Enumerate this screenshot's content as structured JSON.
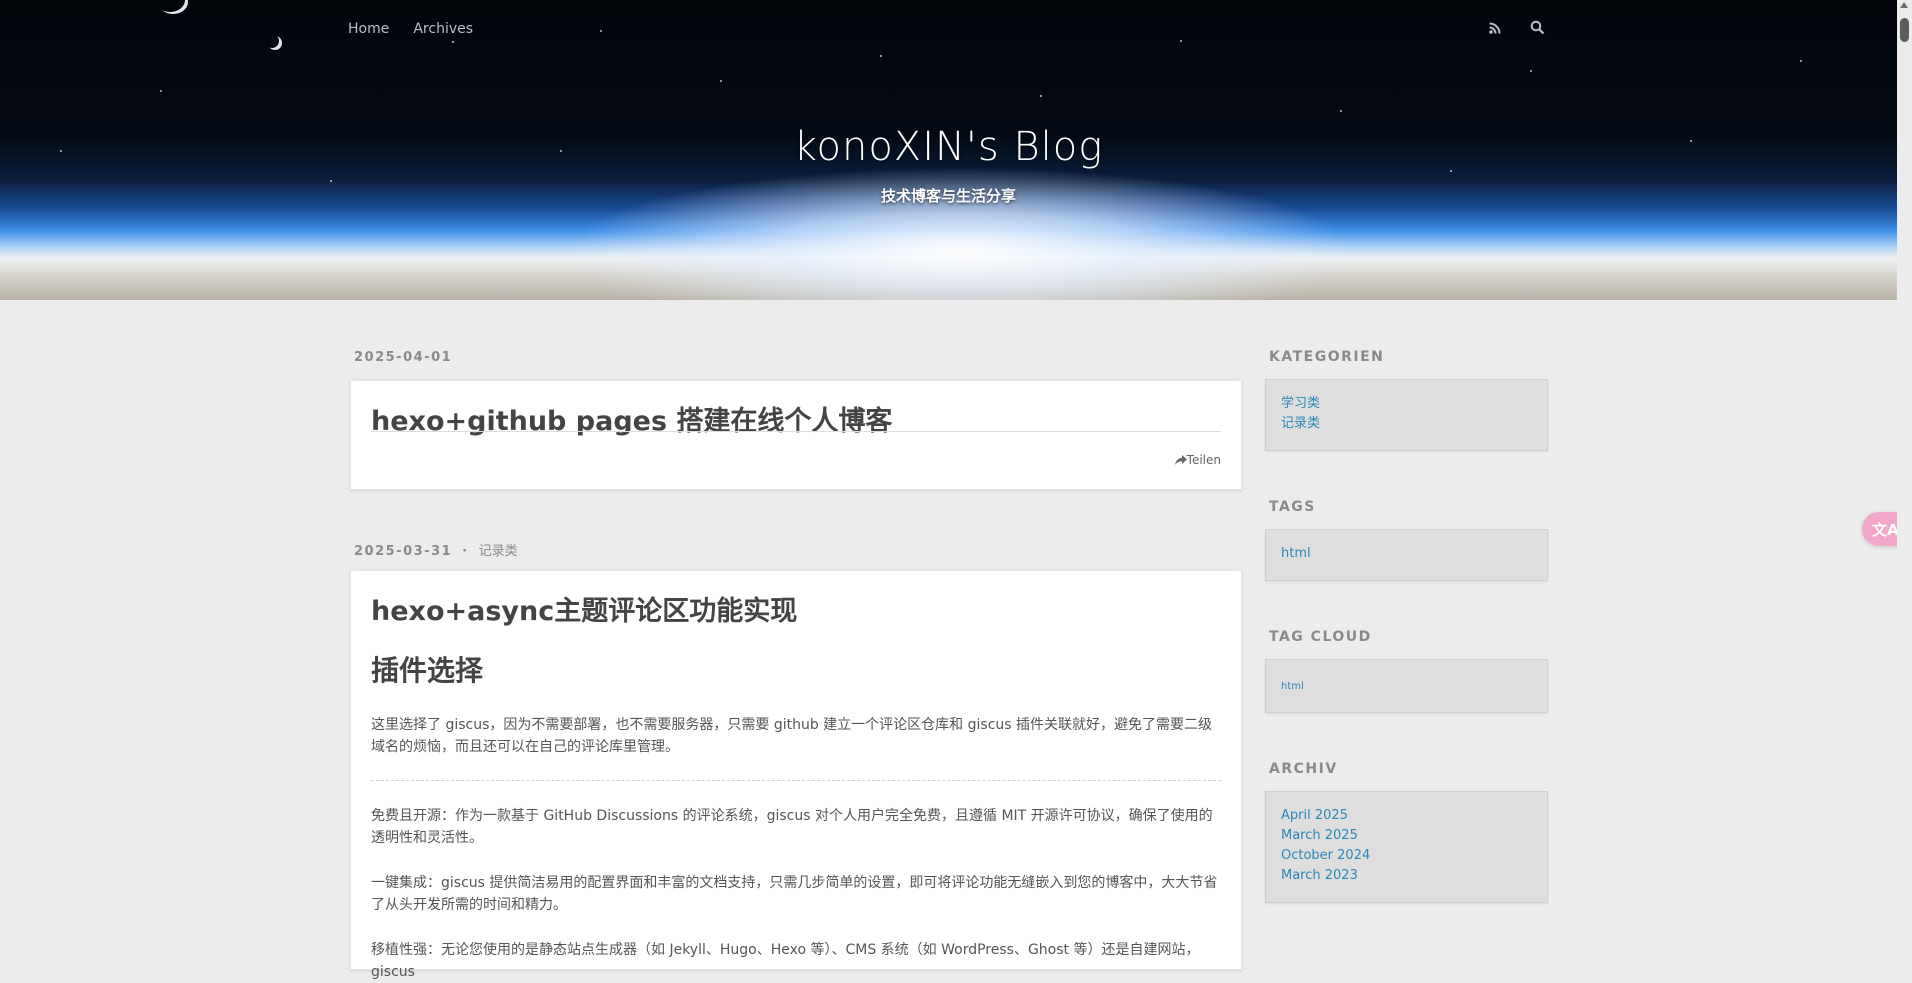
{
  "nav": {
    "home": "Home",
    "archives": "Archives",
    "icons": [
      "rss-icon",
      "search-icon"
    ]
  },
  "site": {
    "title": "konoXIN's Blog",
    "subtitle": "技术博客与生活分享"
  },
  "posts": [
    {
      "date": "2025-04-01",
      "title": "hexo+github pages 搭建在线个人博客",
      "share": "Teilen"
    },
    {
      "date": "2025-03-31",
      "dot": "·",
      "category": "记录类",
      "title": "hexo+async主题评论区功能实现",
      "heading": "插件选择",
      "p1": "这里选择了 giscus，因为不需要部署，也不需要服务器，只需要 github 建立一个评论区仓库和 giscus 插件关联就好，避免了需要二级域名的烦恼，而且还可以在自己的评论库里管理。",
      "p2": "免费且开源：作为一款基于 GitHub Discussions 的评论系统，giscus 对个人用户完全免费，且遵循 MIT 开源许可协议，确保了使用的透明性和灵活性。",
      "p3": "一键集成：giscus 提供简洁易用的配置界面和丰富的文档支持，只需几步简单的设置，即可将评论功能无缝嵌入到您的博客中，大大节省了从头开发所需的时间和精力。",
      "p4": "移植性强：无论您使用的是静态站点生成器（如 Jekyll、Hugo、Hexo 等）、CMS 系统（如 WordPress、Ghost 等）还是自建网站，giscus"
    }
  ],
  "sidebar": {
    "categories": {
      "title": "KATEGORIEN",
      "items": [
        "学习类",
        "记录类"
      ]
    },
    "tags": {
      "title": "TAGS",
      "items": [
        "html"
      ]
    },
    "tag_cloud": {
      "title": "TAG CLOUD",
      "items": [
        "html"
      ]
    },
    "archive": {
      "title": "ARCHIV",
      "items": [
        "April 2025",
        "March 2025",
        "October 2024",
        "March 2023"
      ]
    }
  },
  "translate_button": {
    "label": "文A",
    "icon": "translate-icon"
  },
  "colors": {
    "link": "#2a87b8",
    "background": "#ececec",
    "widget": "#dedede",
    "translate": "#f2a7c8"
  }
}
